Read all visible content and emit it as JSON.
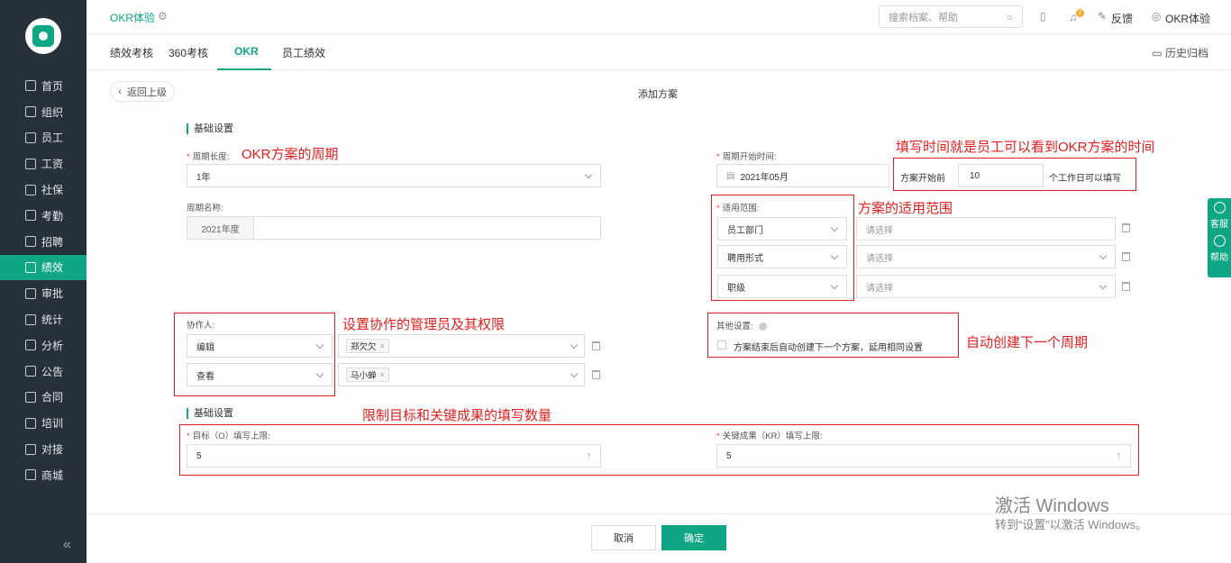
{
  "sidebar": {
    "items": [
      {
        "label": "首页"
      },
      {
        "label": "组织"
      },
      {
        "label": "员工"
      },
      {
        "label": "工资"
      },
      {
        "label": "社保"
      },
      {
        "label": "考勤"
      },
      {
        "label": "招聘"
      },
      {
        "label": "绩效"
      },
      {
        "label": "审批"
      },
      {
        "label": "统计"
      },
      {
        "label": "分析"
      },
      {
        "label": "公告"
      },
      {
        "label": "合同"
      },
      {
        "label": "培训"
      },
      {
        "label": "对接"
      },
      {
        "label": "商城"
      }
    ],
    "active_label": "绩效",
    "collapse_icon": "double-chevron-left-icon"
  },
  "header": {
    "app_title": "OKR体验",
    "search_placeholder": "搜索档案、帮助",
    "badge_count": "0",
    "feedback": "反馈",
    "user": "OKR体验"
  },
  "tabs": {
    "items": [
      {
        "label": "绩效考核"
      },
      {
        "label": "360考核"
      },
      {
        "label": "OKR"
      },
      {
        "label": "员工绩效"
      }
    ],
    "active_label": "OKR",
    "history": "历史归档"
  },
  "page": {
    "back": "返回上级",
    "heading": "添加方案"
  },
  "form": {
    "section1": "基础设置",
    "cycle_length_label": "周期长度:",
    "cycle_length_value": "1年",
    "cycle_name_label": "周期名称:",
    "cycle_name_prefix": "2021年度",
    "cycle_start_label": "周期开始时间:",
    "cycle_start_value": "2021年05月",
    "fill_prefix": "方案开始前",
    "fill_days": "10",
    "fill_suffix": "个工作日可以填写",
    "scope_label": "适用范围:",
    "scope_rows": [
      {
        "key": "员工部门",
        "value": "请选择"
      },
      {
        "key": "聘用形式",
        "value": "请选择"
      },
      {
        "key": "职级",
        "value": "请选择"
      }
    ],
    "collab_label": "协作人:",
    "collab_rows": [
      {
        "role": "编辑",
        "person": "郑欠欠"
      },
      {
        "role": "查看",
        "person": "马小蝉"
      }
    ],
    "other_label": "其他设置:",
    "auto_create_text": "方案结束后自动创建下一个方案，延用相同设置",
    "auto_create_checked": false,
    "section2": "基础设置",
    "objective_limit_label": "目标（O）填写上限:",
    "objective_limit_value": "5",
    "kr_limit_label": "关键成果（KR）填写上限:",
    "kr_limit_value": "5"
  },
  "annotations": {
    "cycle": "OKR方案的周期",
    "fill_time": "填写时间就是员工可以看到OKR方案的时间",
    "scope": "方案的适用范围",
    "collab": "设置协作的管理员及其权限",
    "auto": "自动创建下一个周期",
    "limits": "限制目标和关键成果的填写数量",
    "annotation_color": "#e02020"
  },
  "footer": {
    "cancel": "取消",
    "confirm": "确定"
  },
  "float_panel": {
    "service": "客服",
    "help": "帮助"
  },
  "watermark": {
    "line1": "激活 Windows",
    "line2": "转到“设置”以激活 Windows。"
  },
  "colors": {
    "accent": "#0fa783",
    "sidebar": "#26313c"
  }
}
